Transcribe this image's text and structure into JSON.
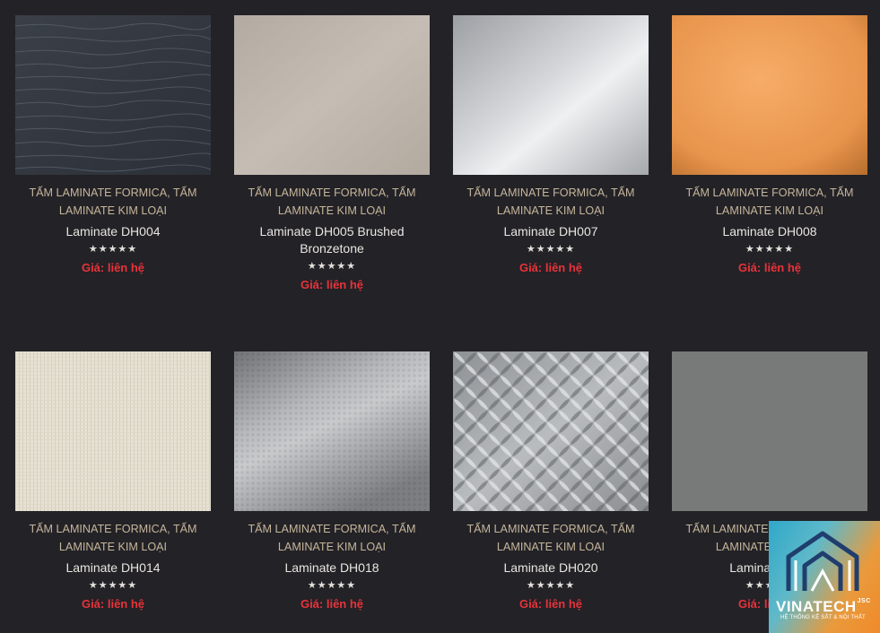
{
  "products": [
    {
      "cat1": "TẤM LAMINATE FORMICA",
      "cat2": "TẤM LAMINATE KIM LOẠI",
      "title": "Laminate DH004",
      "rating": 5,
      "price": "Giá: liên hệ",
      "texture": "dark-wave"
    },
    {
      "cat1": "TẤM LAMINATE FORMICA",
      "cat2": "TẤM LAMINATE KIM LOẠI",
      "title": "Laminate DH005 Brushed Bronzetone",
      "rating": 5,
      "price": "Giá: liên hệ",
      "texture": "bronze"
    },
    {
      "cat1": "TẤM LAMINATE FORMICA",
      "cat2": "TẤM LAMINATE KIM LOẠI",
      "title": "Laminate DH007",
      "rating": 5,
      "price": "Giá: liên hệ",
      "texture": "silver"
    },
    {
      "cat1": "TẤM LAMINATE FORMICA",
      "cat2": "TẤM LAMINATE KIM LOẠI",
      "title": "Laminate DH008",
      "rating": 5,
      "price": "Giá: liên hệ",
      "texture": "copper"
    },
    {
      "cat1": "TẤM LAMINATE FORMICA",
      "cat2": "TẤM LAMINATE KIM LOẠI",
      "title": "Laminate DH014",
      "rating": 5,
      "price": "Giá: liên hệ",
      "texture": "linen"
    },
    {
      "cat1": "TẤM LAMINATE FORMICA",
      "cat2": "TẤM LAMINATE KIM LOẠI",
      "title": "Laminate DH018",
      "rating": 5,
      "price": "Giá: liên hệ",
      "texture": "hammered"
    },
    {
      "cat1": "TẤM LAMINATE FORMICA",
      "cat2": "TẤM LAMINATE KIM LOẠI",
      "title": "Laminate DH020",
      "rating": 5,
      "price": "Giá: liên hệ",
      "texture": "diamond-plate"
    },
    {
      "cat1": "TẤM LAMINATE FORMICA",
      "cat2": "TẤM LAMINATE KIM LOẠI",
      "title": "Laminate DH0",
      "rating": 5,
      "price": "Giá: liên hệ",
      "texture": "gray"
    }
  ],
  "logo": {
    "name": "VINATECH",
    "suffix": "JSC",
    "tagline": "HỆ THỐNG KỆ SẮT & NỘI THẤT"
  },
  "separator": ", "
}
